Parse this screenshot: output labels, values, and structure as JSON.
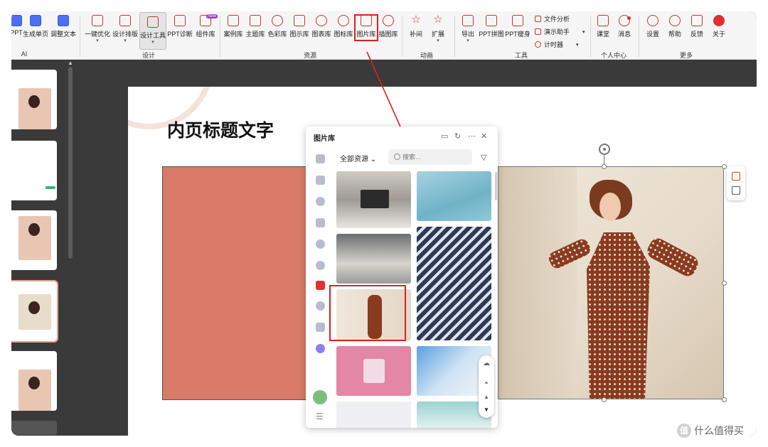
{
  "ribbon": {
    "ai_group": {
      "label": "AI",
      "buttons": [
        "PPT",
        "生成单页",
        "调整文本"
      ]
    },
    "design_group": {
      "label": "设计",
      "buttons": [
        "一键优化",
        "设计排版",
        "设计工具",
        "PPT诊断",
        "组件库"
      ],
      "new_badge": "New"
    },
    "resource_group": {
      "label": "资源",
      "buttons": [
        "案例库",
        "主题库",
        "色彩库",
        "图示库",
        "图表库",
        "图标库",
        "图片库",
        "插图库"
      ]
    },
    "animation_group": {
      "label": "动画",
      "buttons": [
        "补间",
        "扩展"
      ]
    },
    "tools_group": {
      "label": "工具",
      "buttons": [
        "导出",
        "PPT拼图",
        "PPT瘦身"
      ],
      "mini": [
        "文件分析",
        "演示助手",
        "计时器"
      ]
    },
    "personal_group": {
      "label": "个人中心",
      "buttons": [
        "课堂",
        "消息"
      ]
    },
    "more_group": {
      "label": "更多",
      "buttons": [
        "设置",
        "帮助",
        "反馈",
        "关于"
      ]
    }
  },
  "slide": {
    "title": "内页标题文字"
  },
  "panel": {
    "title": "图片库",
    "filter_label": "全部资源",
    "search_placeholder": "搜索..."
  },
  "watermark": {
    "text": "什么值得买",
    "icon_text": "值"
  }
}
